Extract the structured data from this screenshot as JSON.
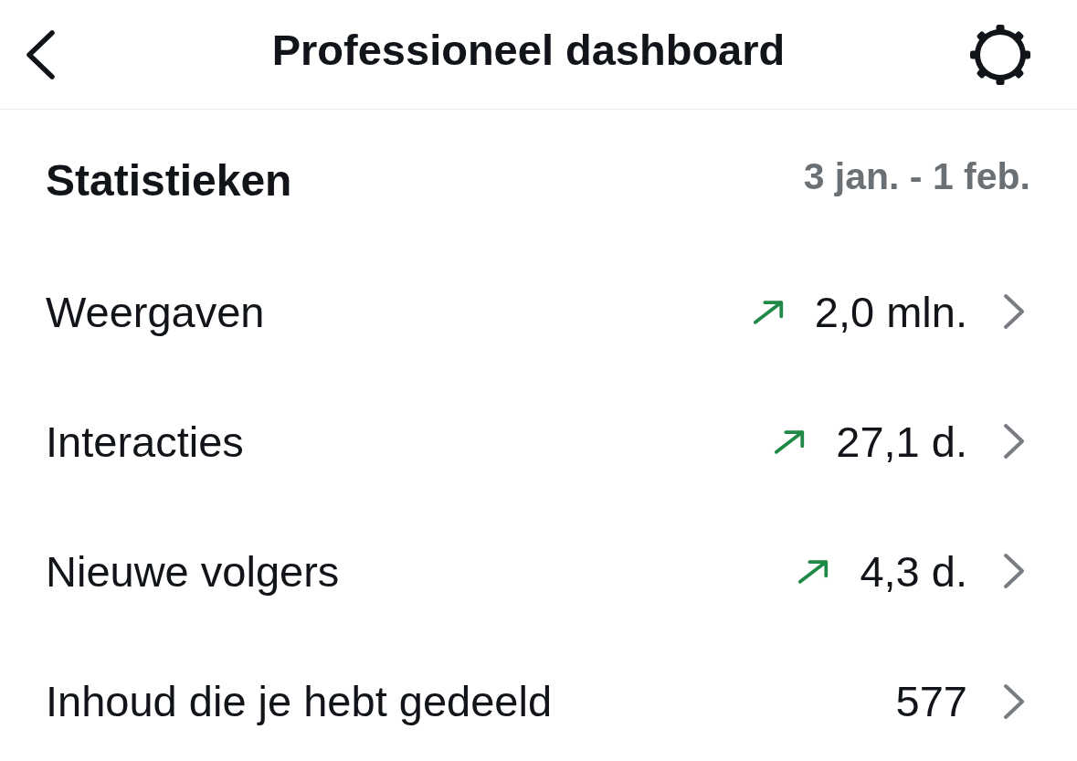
{
  "header": {
    "title": "Professioneel dashboard"
  },
  "section": {
    "title": "Statistieken",
    "date_range": "3 jan. - 1 feb."
  },
  "stats": [
    {
      "label": "Weergaven",
      "trend_up": true,
      "value": "2,0 mln."
    },
    {
      "label": "Interacties",
      "trend_up": true,
      "value": "27,1 d."
    },
    {
      "label": "Nieuwe volgers",
      "trend_up": true,
      "value": "4,3 d."
    },
    {
      "label": "Inhoud die je hebt gedeeld",
      "trend_up": false,
      "value": "577"
    }
  ]
}
